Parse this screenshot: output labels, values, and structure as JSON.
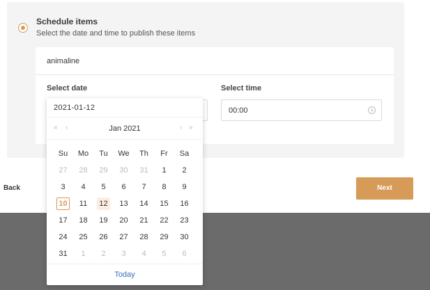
{
  "schedule": {
    "title": "Schedule items",
    "description": "Select the date and time to publish these items",
    "item_name": "animaline",
    "date_label": "Select date",
    "time_label": "Select time",
    "time_value": "00:00"
  },
  "footer": {
    "back_label": "Back",
    "next_label": "Next"
  },
  "colors": {
    "accent": "#d59b57",
    "link": "#3b6fb6"
  },
  "picker": {
    "input_value": "2021-01-12",
    "nav_prev_year": "«",
    "nav_prev_month": "‹",
    "nav_next_month": "›",
    "nav_next_year": "»",
    "month_label": "Jan 2021",
    "weekdays": [
      "Su",
      "Mo",
      "Tu",
      "We",
      "Th",
      "Fr",
      "Sa"
    ],
    "weeks": [
      [
        "27",
        "28",
        "29",
        "30",
        "31",
        "1",
        "2"
      ],
      [
        "3",
        "4",
        "5",
        "6",
        "7",
        "8",
        "9"
      ],
      [
        "10",
        "11",
        "12",
        "13",
        "14",
        "15",
        "16"
      ],
      [
        "17",
        "18",
        "19",
        "20",
        "21",
        "22",
        "23"
      ],
      [
        "24",
        "25",
        "26",
        "27",
        "28",
        "29",
        "30"
      ],
      [
        "31",
        "1",
        "2",
        "3",
        "4",
        "5",
        "6"
      ]
    ],
    "today_label": "Today"
  }
}
